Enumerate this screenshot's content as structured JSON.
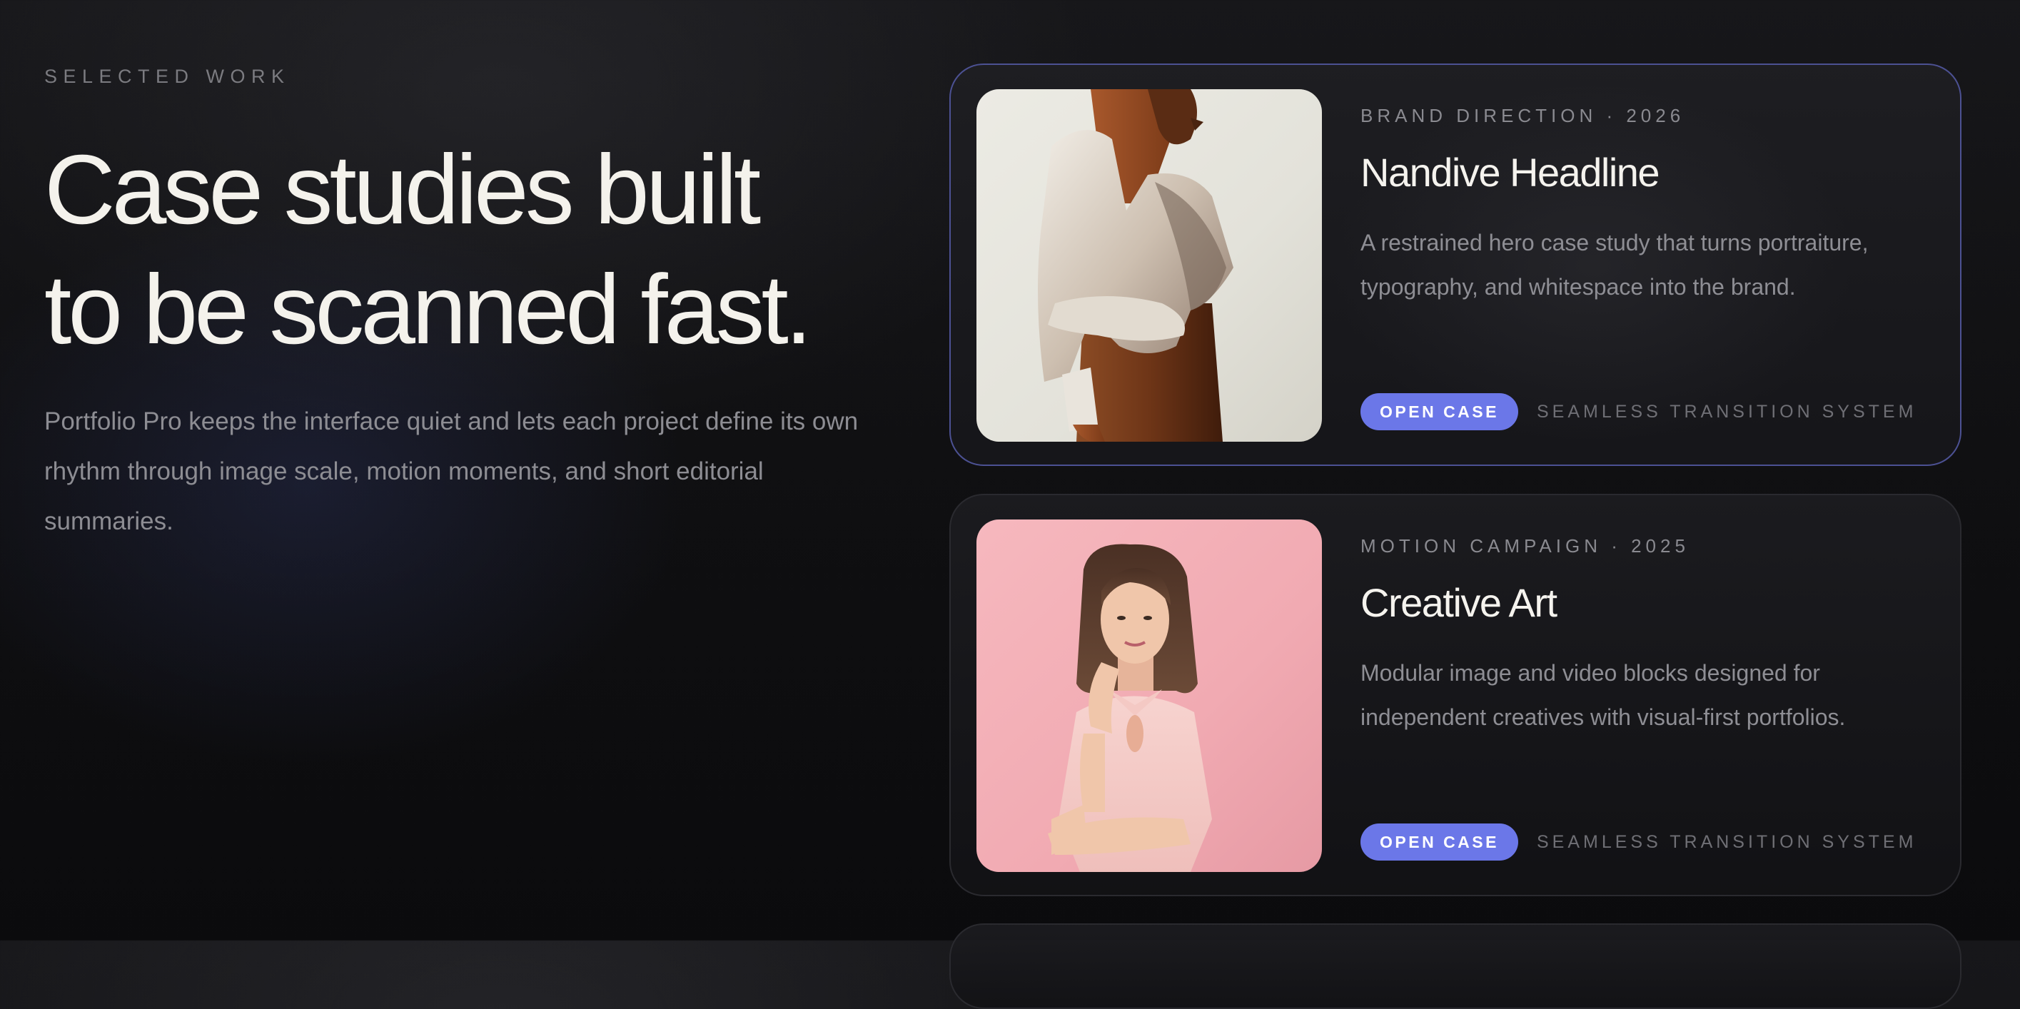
{
  "intro_section": {
    "eyebrow": "SELECTED WORK",
    "headline_line1": "Case studies built",
    "headline_line2": "to be scanned fast.",
    "description": "Portfolio Pro keeps the interface quiet and lets each project define its own rhythm through image scale, motion moments, and short editorial summaries."
  },
  "cases": [
    {
      "meta": "BRAND DIRECTION · 2026",
      "title": "Nandive Headline",
      "description": "A restrained hero case study that turns portraiture, typography, and whitespace into the brand.",
      "button_label": "OPEN CASE",
      "tag": "SEAMLESS TRANSITION SYSTEM",
      "active": true
    },
    {
      "meta": "MOTION CAMPAIGN · 2025",
      "title": "Creative Art",
      "description": "Modular image and video blocks designed for independent creatives with visual-first portfolios.",
      "button_label": "OPEN CASE",
      "tag": "SEAMLESS TRANSITION SYSTEM",
      "active": false
    }
  ],
  "colors": {
    "accent": "#6b77e8",
    "active_border": "#4c5193",
    "background": "#111113",
    "text_primary": "#f4f2ec",
    "text_muted": "#8d8d93"
  }
}
